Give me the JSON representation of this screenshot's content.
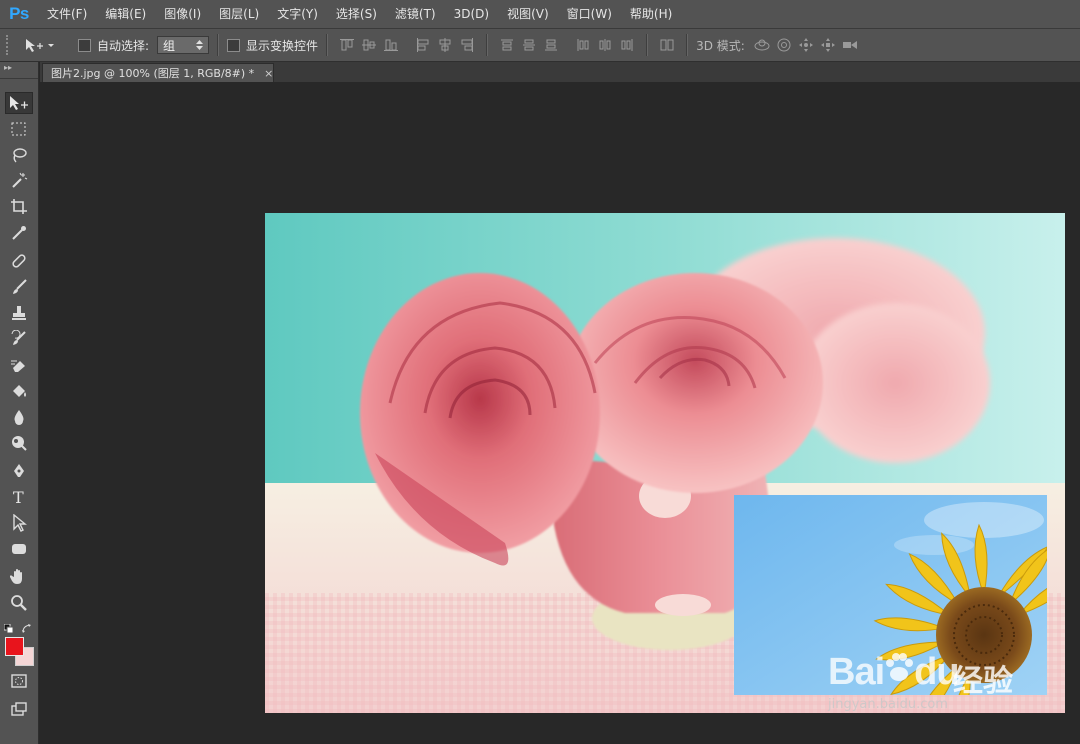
{
  "app": {
    "logo": "Ps"
  },
  "menu": [
    "文件(F)",
    "编辑(E)",
    "图像(I)",
    "图层(L)",
    "文字(Y)",
    "选择(S)",
    "滤镜(T)",
    "3D(D)",
    "视图(V)",
    "窗口(W)",
    "帮助(H)"
  ],
  "options": {
    "auto_select_label": "自动选择:",
    "auto_select_value": "组",
    "show_transform_label": "显示变换控件",
    "mode_3d_label": "3D 模式:"
  },
  "document": {
    "tab_title": "图片2.jpg @ 100% (图层 1, RGB/8#) *",
    "close_glyph": "×"
  },
  "watermark": {
    "brand": "Bai",
    "brand_tail": "du",
    "cn": "经验",
    "url": "jingyan.baidu.com"
  },
  "colors": {
    "foreground": "#e8141c",
    "background": "#f4d6d6",
    "accent": "#31a8ff"
  }
}
